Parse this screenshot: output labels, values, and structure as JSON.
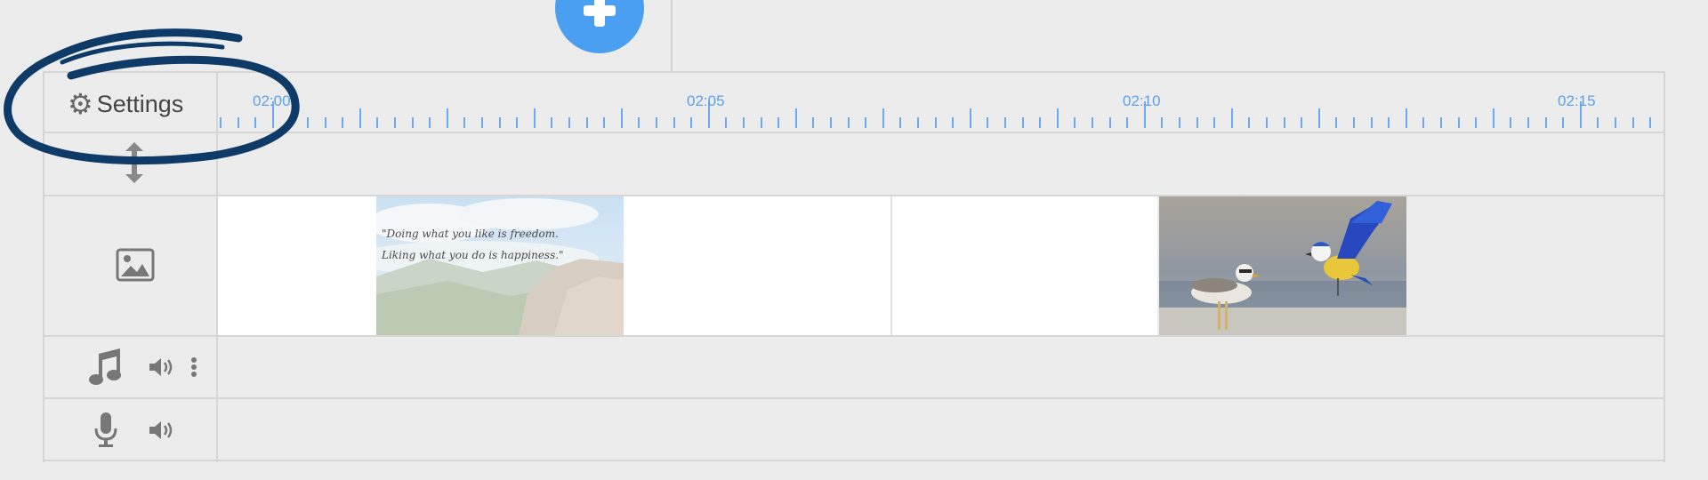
{
  "header": {
    "title": "",
    "add_button_symbol": "+"
  },
  "toolbar": {
    "settings_label": "Settings"
  },
  "timeline": {
    "labels": [
      "02:00",
      "02:05",
      "02:10",
      "02:15"
    ]
  },
  "clips": {
    "quote_line1": "\"Doing what you like is freedom.",
    "quote_line2": "Liking what you do is happiness.\""
  },
  "colors": {
    "accent": "#4a9ff0",
    "annotation_circle": "#0d3a66",
    "tick": "#6aaaf0"
  },
  "icons": [
    "gear-icon",
    "resize-vertical-icon",
    "image-icon",
    "music-note-icon",
    "volume-icon",
    "more-vertical-icon",
    "microphone-icon"
  ]
}
